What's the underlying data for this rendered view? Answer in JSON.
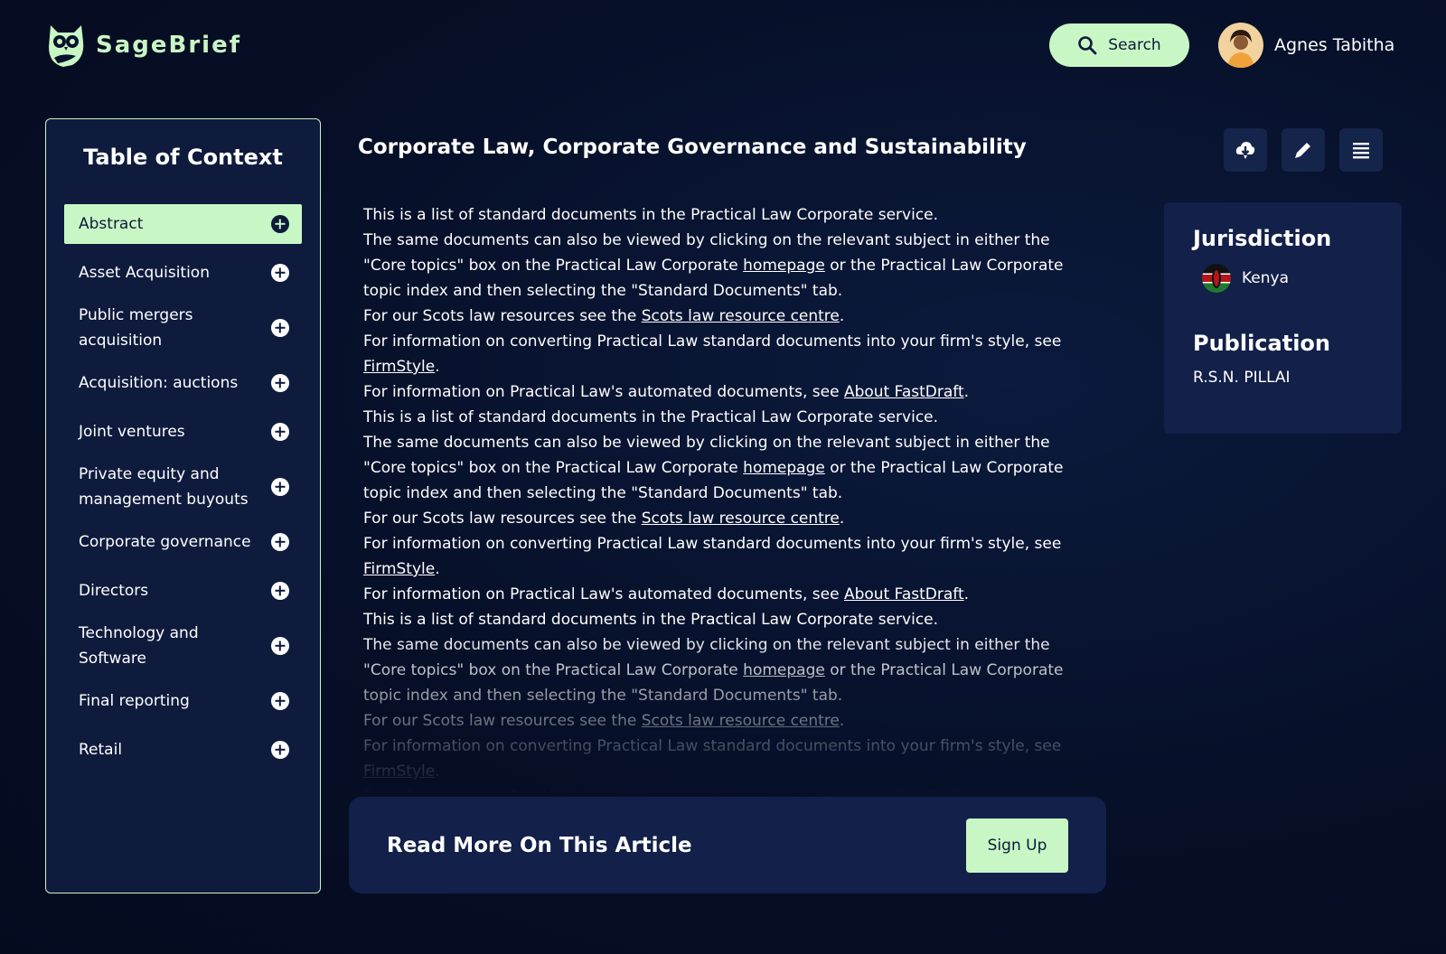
{
  "header": {
    "brand": "SageBrief",
    "search_label": "Search",
    "user_name": "Agnes Tabitha"
  },
  "toc": {
    "title": "Table of Context",
    "items": [
      {
        "label": "Abstract",
        "active": true
      },
      {
        "label": "Asset Acquisition"
      },
      {
        "label": "Public mergers acquisition"
      },
      {
        "label": "Acquisition: auctions"
      },
      {
        "label": "Joint ventures"
      },
      {
        "label": "Private equity and management buyouts"
      },
      {
        "label": "Corporate governance"
      },
      {
        "label": "Directors"
      },
      {
        "label": "Technology and Software"
      },
      {
        "label": "Final reporting"
      },
      {
        "label": "Retail"
      }
    ]
  },
  "article": {
    "title": "Corporate Law, Corporate Governance and Sustainability",
    "line1": "This is a list of standard documents in the Practical Law Corporate service.",
    "line2_pre": "The same documents can also be viewed by clicking on the relevant subject in either the \"Core topics\" box on the Practical Law Corporate ",
    "line2_link": "homepage",
    "line2_post": " or the Practical Law Corporate topic index and then selecting the \"Standard Documents\" tab.",
    "line3_pre": "For our Scots law resources see the ",
    "line3_link": "Scots law resource centre",
    "line3_post": ".",
    "line4_pre": "For information on converting Practical Law standard documents into your firm's style, see ",
    "line4_link": "FirmStyle",
    "line4_post": ".",
    "line5_pre": "For information on Practical Law's automated documents, see ",
    "line5_link": "About FastDraft",
    "line5_post": "."
  },
  "info": {
    "jurisdiction_heading": "Jurisdiction",
    "jurisdiction": "Kenya",
    "publication_heading": "Publication",
    "publication": "R.S.N. PILLAI"
  },
  "read_more": {
    "title": "Read More On This Article",
    "button": "Sign Up"
  },
  "colors": {
    "background": "#06112b",
    "accent": "#c8f7c5",
    "card": "#12204a"
  },
  "icons": [
    "owl-logo-icon",
    "search-icon",
    "download-icon",
    "edit-icon",
    "menu-icon",
    "plus-circle-icon",
    "kenya-flag-icon"
  ]
}
